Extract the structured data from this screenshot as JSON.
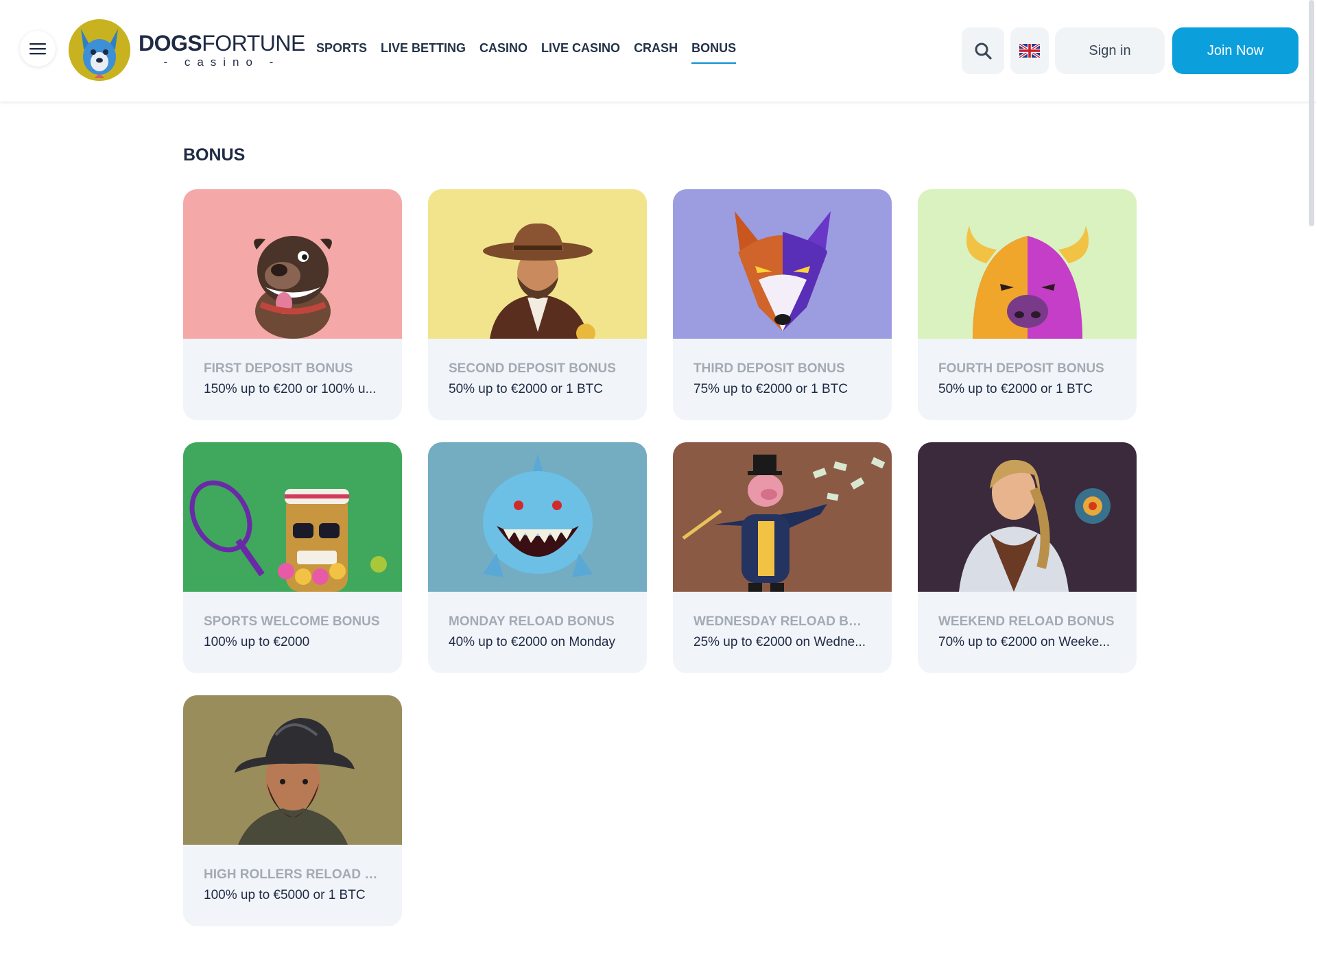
{
  "header": {
    "logo": {
      "brand_bold": "DOGS",
      "brand_light": "FORTUNE",
      "sub": "- casino -"
    },
    "nav": [
      {
        "label": "SPORTS",
        "active": false
      },
      {
        "label": "LIVE BETTING",
        "active": false
      },
      {
        "label": "CASINO",
        "active": false
      },
      {
        "label": "LIVE CASINO",
        "active": false
      },
      {
        "label": "CRASH",
        "active": false
      },
      {
        "label": "BONUS",
        "active": true
      }
    ],
    "signin_label": "Sign in",
    "join_label": "Join Now",
    "language_icon": "uk-flag-icon",
    "search_icon": "search-icon"
  },
  "main": {
    "title": "BONUS",
    "cards": [
      {
        "title": "FIRST DEPOSIT BONUS",
        "desc": "150% up to €200 or 100% u...",
        "bg": "#f4a9a8",
        "icon": "dog-character"
      },
      {
        "title": "SECOND DEPOSIT BONUS",
        "desc": "50% up to €2000 or 1 BTC",
        "bg": "#f2e48c",
        "icon": "cowboy-character"
      },
      {
        "title": "THIRD DEPOSIT BONUS",
        "desc": "75% up to €2000 or 1 BTC",
        "bg": "#9b9de0",
        "icon": "wolf-character"
      },
      {
        "title": "FOURTH DEPOSIT BONUS",
        "desc": "50% up to €2000 or 1 BTC",
        "bg": "#d9f2c0",
        "icon": "buffalo-character"
      },
      {
        "title": "SPORTS WELCOME BONUS",
        "desc": "100% up to €2000",
        "bg": "#3fa85c",
        "icon": "tiki-tennis-character"
      },
      {
        "title": "MONDAY RELOAD BONUS",
        "desc": "40% up to €2000 on Monday",
        "bg": "#74acc2",
        "icon": "shark-character"
      },
      {
        "title": "WEDNESDAY RELOAD BON...",
        "desc": "25% up to €2000 on Wedne...",
        "bg": "#8b5a45",
        "icon": "pig-tycoon-character"
      },
      {
        "title": "WEEKEND RELOAD BONUS",
        "desc": "70% up to €2000 on Weeke...",
        "bg": "#3a2a3c",
        "icon": "explorer-woman-character"
      },
      {
        "title": "HIGH ROLLERS RELOAD B...",
        "desc": "100% up to €5000 or 1 BTC",
        "bg": "#9a8d5c",
        "icon": "conquistador-character"
      }
    ]
  },
  "colors": {
    "accent": "#0b9fdc",
    "text_dark": "#1f2a44",
    "muted": "#a3aab3",
    "card_bg": "#f1f5f9"
  }
}
